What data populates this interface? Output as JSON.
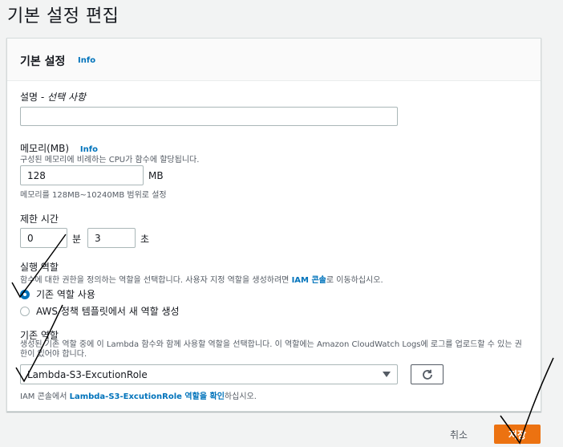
{
  "page": {
    "title": "기본 설정 편집"
  },
  "panel": {
    "title": "기본 설정",
    "info": "Info"
  },
  "description": {
    "label": "설명",
    "optional": " - 선택 사항",
    "value": ""
  },
  "memory": {
    "label": "메모리(MB)",
    "info": "Info",
    "help": "구성된 메모리에 비례하는 CPU가 함수에 할당됩니다.",
    "value": "128",
    "unit": "MB",
    "range": "메모리를 128MB~10240MB 범위로 설정"
  },
  "timeout": {
    "label": "제한 시간",
    "minutes": "0",
    "min_unit": "분",
    "seconds": "3",
    "sec_unit": "초"
  },
  "exec_role": {
    "label": "실행 역할",
    "help_prefix": "함수에 대한 권한을 정의하는 역할을 선택합니다. 사용자 지정 역할을 생성하려면 ",
    "help_link": "IAM 콘솔",
    "help_suffix": "로 이동하십시오.",
    "options": [
      "기존 역할 사용",
      "AWS 정책 템플릿에서 새 역할 생성"
    ],
    "selected": "기존 역할 사용"
  },
  "existing_role": {
    "label": "기존 역할",
    "help": "생성된 기존 역할 중에 이 Lambda 함수와 함께 사용할 역할을 선택합니다. 이 역할에는 Amazon CloudWatch Logs에 로그를 업로드할 수 있는 권한이 있어야 합니다.",
    "selected": "Lambda-S3-ExcutionRole",
    "note_prefix": "IAM 콘솔에서 ",
    "note_link": "Lambda-S3-ExcutionRole 역할을 확인",
    "note_suffix": "하십시오.",
    "refresh_icon": "refresh-icon"
  },
  "footer": {
    "cancel": "취소",
    "save": "저장"
  },
  "colors": {
    "accent": "#0073bb",
    "primary_button": "#ec7211"
  }
}
